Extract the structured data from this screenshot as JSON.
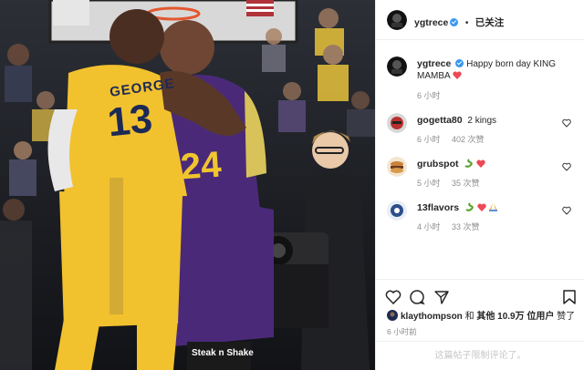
{
  "post": {
    "author": "ygtrece",
    "dot": "•",
    "follow_status": "已关注",
    "jersey_george_name": "GEORGE",
    "jersey_george_number": "13",
    "jersey_kobe_number": "24",
    "sponsor_text": "Steak n Shake"
  },
  "caption": {
    "username": "ygtrece",
    "text": "Happy born day KING MAMBA",
    "time": "6 小时"
  },
  "comments": [
    {
      "username": "gogetta80",
      "text": "2 kings",
      "time": "6 小时",
      "likes": "402 次赞",
      "reply": ""
    },
    {
      "username": "grubspot",
      "text": "",
      "time": "5 小时",
      "likes": "35 次赞",
      "reply": ""
    },
    {
      "username": "13flavors",
      "text": "",
      "time": "4 小时",
      "likes": "33 次赞",
      "reply": ""
    }
  ],
  "actions": {
    "like_icon": "heart-outline-icon",
    "comment_icon": "comment-icon",
    "share_icon": "share-icon",
    "save_icon": "bookmark-icon"
  },
  "likes_line": {
    "username": "klaythompson",
    "conj": "和",
    "others": "其他 10.9万 位用户",
    "suffix": "赞了"
  },
  "posted_ago": "6 小时前",
  "comments_disabled": "这篇帖子限制评论了。",
  "colors": {
    "heart_red": "#ed4956",
    "verified_blue": "#3897f0",
    "meta_gray": "#8e8e8e"
  }
}
